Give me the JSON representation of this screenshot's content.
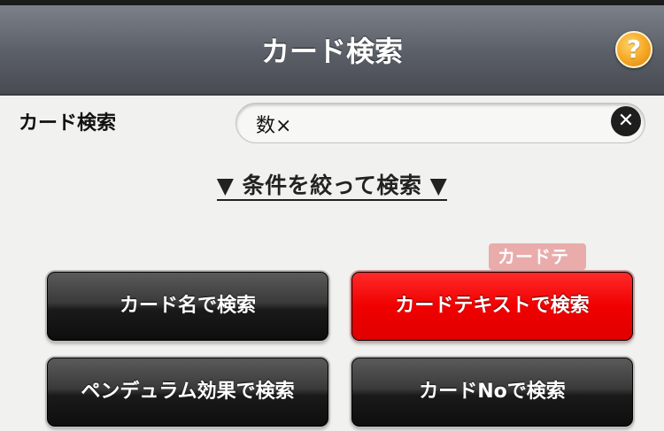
{
  "header": {
    "title": "カード検索",
    "help_label": "?",
    "help_icon": "question-icon",
    "help_color": "#f5a623"
  },
  "search": {
    "label": "カード検索",
    "value": "数×",
    "clear_label": "✕",
    "clear_icon": "clear-icon"
  },
  "filter_link": "▼ 条件を絞って検索 ▼",
  "tooltip_label": "カードテ",
  "buttons": {
    "card_name": "カード名で検索",
    "card_text": "カードテキストで検索",
    "pendulum": "ペンデュラム効果で検索",
    "card_no": "カードNoで検索"
  },
  "colors": {
    "active_button": "#ff0000",
    "header": "#5a5e66"
  }
}
